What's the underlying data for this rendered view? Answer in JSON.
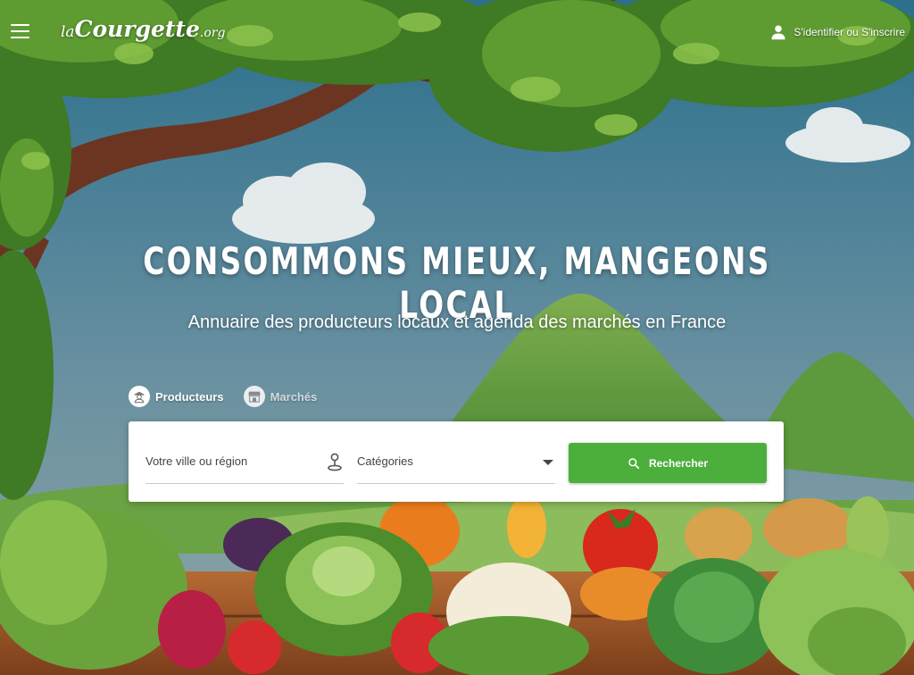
{
  "header": {
    "logo_prefix": "la",
    "logo_main": "Courgette",
    "logo_suffix": ".org",
    "auth_label": "S'identifier ou S'inscrire"
  },
  "hero": {
    "headline": "CONSOMMONS MIEUX, MANGEONS LOCAL",
    "subline": "Annuaire des producteurs locaux et agenda des marchés en  France"
  },
  "tabs": [
    {
      "label": "Producteurs",
      "icon": "farmer-icon",
      "active": true
    },
    {
      "label": "Marchés",
      "icon": "market-stall-icon",
      "active": false
    }
  ],
  "search": {
    "city_placeholder": "Votre ville ou région",
    "category_label": "Catégories",
    "button_label": "Rechercher"
  },
  "colors": {
    "accent_green": "#4caf3c",
    "sky": "#6c9bb0",
    "foliage": "#4f8a2c"
  }
}
